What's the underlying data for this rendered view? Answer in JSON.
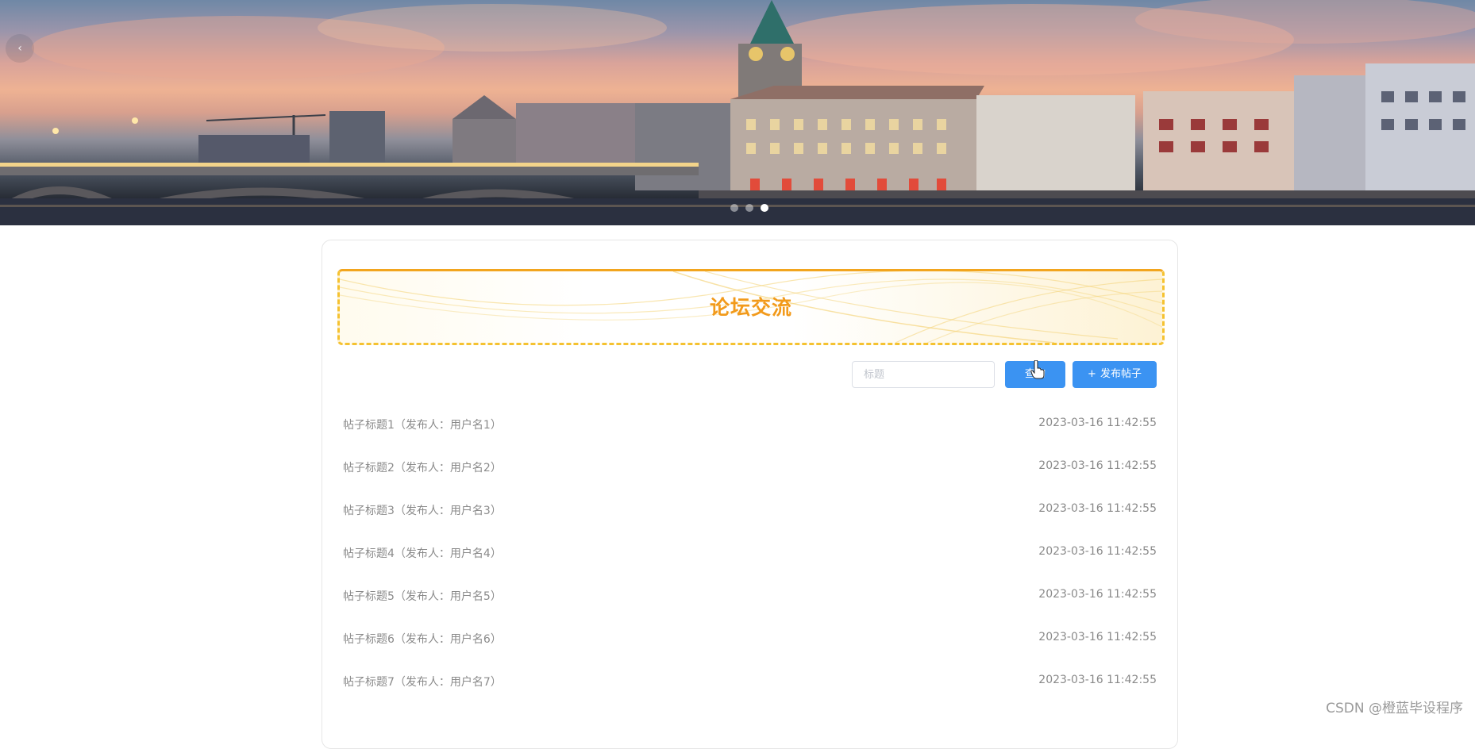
{
  "banner": {
    "prev_arrow": "‹",
    "slide_count": 3,
    "active_slide": 3
  },
  "forum": {
    "title": "论坛交流",
    "search": {
      "placeholder": "标题",
      "value": ""
    },
    "search_button": "查询",
    "add_button": "发布帖子",
    "add_icon": "+",
    "posts": [
      {
        "title": "帖子标题1（发布人：用户名1）",
        "time": "2023-03-16 11:42:55"
      },
      {
        "title": "帖子标题2（发布人：用户名2）",
        "time": "2023-03-16 11:42:55"
      },
      {
        "title": "帖子标题3（发布人：用户名3）",
        "time": "2023-03-16 11:42:55"
      },
      {
        "title": "帖子标题4（发布人：用户名4）",
        "time": "2023-03-16 11:42:55"
      },
      {
        "title": "帖子标题5（发布人：用户名5）",
        "time": "2023-03-16 11:42:55"
      },
      {
        "title": "帖子标题6（发布人：用户名6）",
        "time": "2023-03-16 11:42:55"
      },
      {
        "title": "帖子标题7（发布人：用户名7）",
        "time": "2023-03-16 11:42:55"
      }
    ]
  },
  "watermark": "CSDN @橙蓝毕设程序",
  "colors": {
    "primary": "#3b93f2",
    "title_orange": "#f29a1b",
    "border_gold": "#f5c231"
  }
}
